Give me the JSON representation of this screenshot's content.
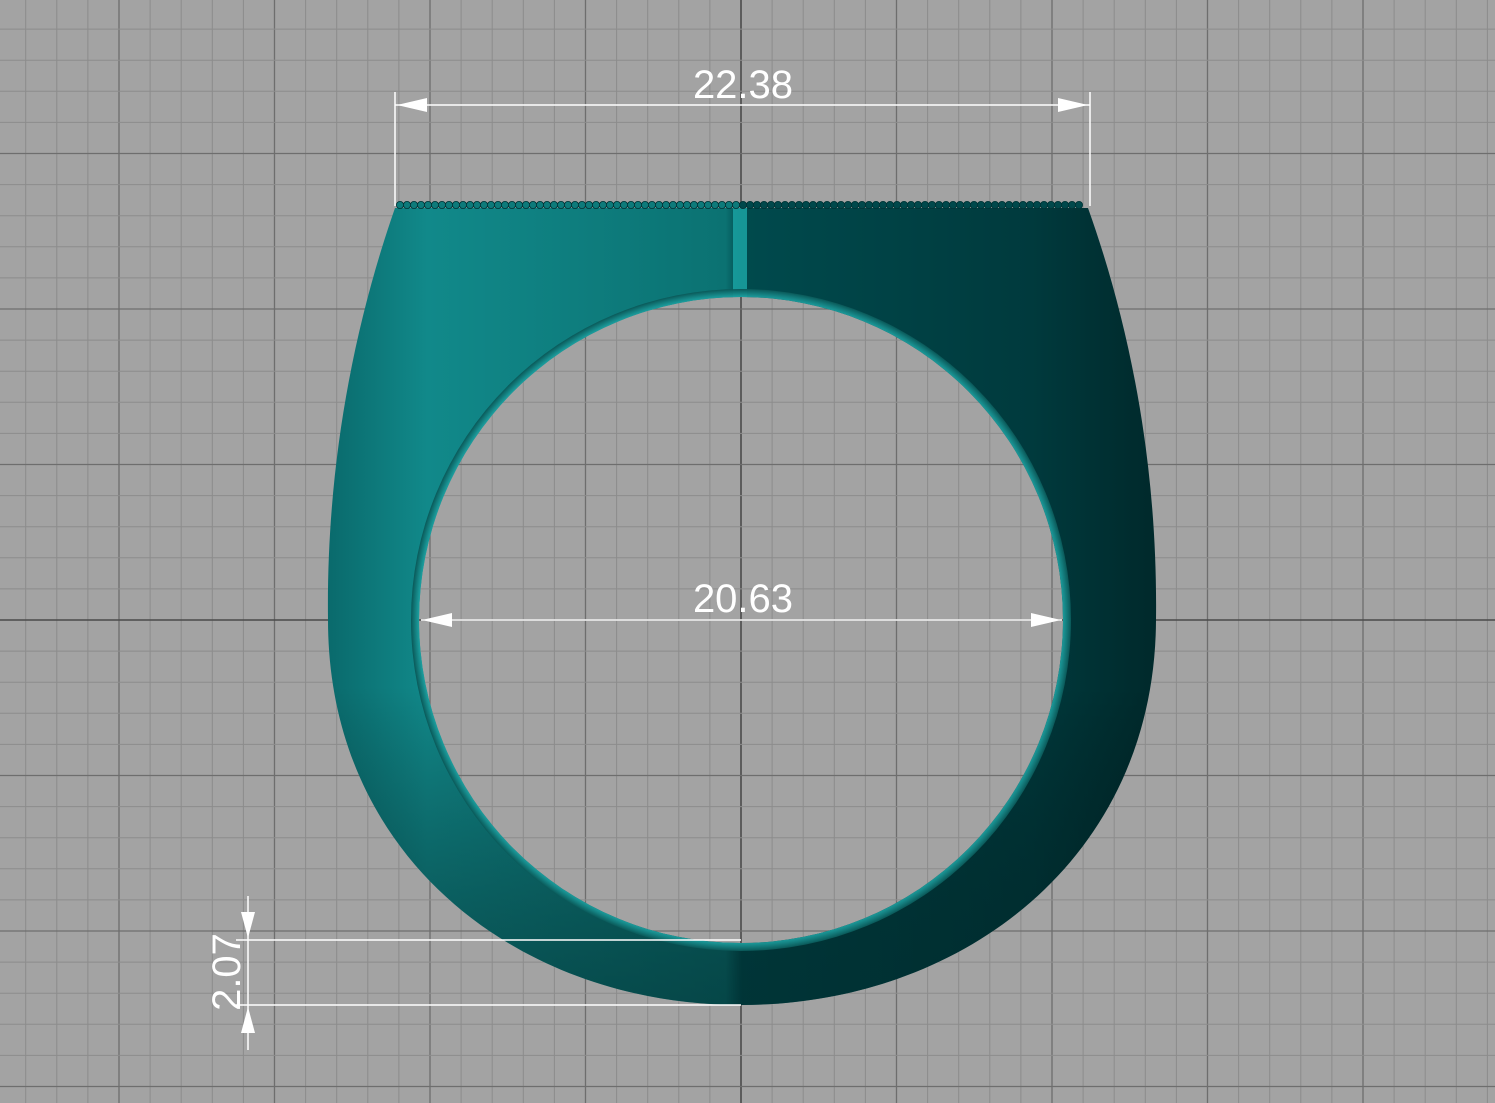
{
  "viewport": {
    "background_color": "#a3a3a3",
    "grid_minor_color": "#8c8c8c",
    "grid_major_color": "#6e6e6e",
    "axis_color": "#4a4a4a"
  },
  "model": {
    "name": "ring",
    "body_color": "#0e7c7c",
    "shadow_color": "#003b3e"
  },
  "dimensions": {
    "top_width": "22.38",
    "inner_diameter": "20.63",
    "shank_thickness": "2.07",
    "line_color": "#ffffff"
  }
}
